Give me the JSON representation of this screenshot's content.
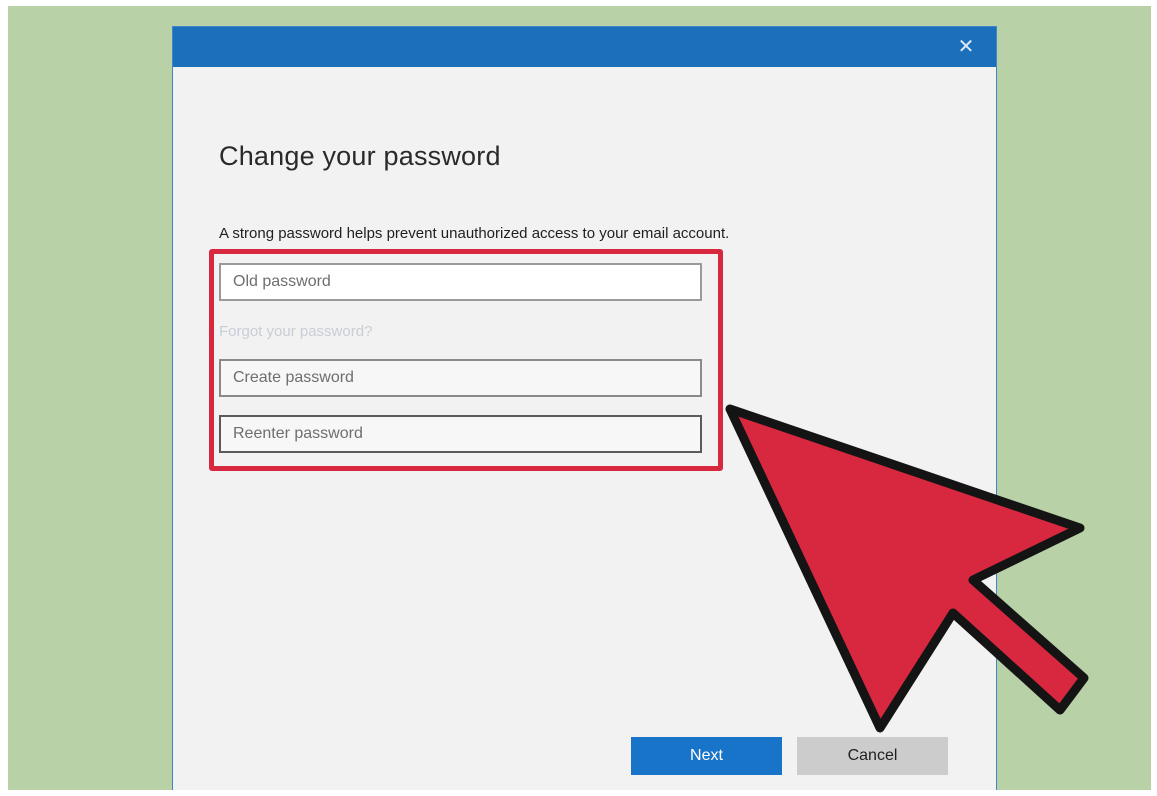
{
  "dialog": {
    "title": "Change your password",
    "description": "A strong password helps prevent unauthorized access to your email account.",
    "close_icon": "close-icon",
    "titlebar_color": "#1c6fba"
  },
  "fields": {
    "old_password_placeholder": "Old password",
    "forgot_link": "Forgot your password?",
    "create_password_placeholder": "Create password",
    "reenter_password_placeholder": "Reenter password"
  },
  "buttons": {
    "next": "Next",
    "cancel": "Cancel"
  },
  "annotations": {
    "highlight_color": "#d8283f",
    "pointer_arrow": "pointer-arrow-icon"
  }
}
